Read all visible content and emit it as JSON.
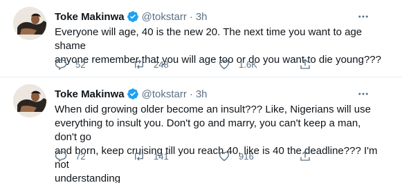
{
  "tweets": [
    {
      "name": "Toke Makinwa",
      "handle": "@tokstarr",
      "separator": "·",
      "time": "3h",
      "lines": [
        "Everyone will age, 40 is the new 20. The next time you want to age shame",
        "anyone remember that you will age too or do you want to die young???"
      ],
      "replies": "52",
      "retweets": "248",
      "likes": "1.6K"
    },
    {
      "name": "Toke Makinwa",
      "handle": "@tokstarr",
      "separator": "·",
      "time": "3h",
      "lines": [
        "When did growing older become an insult??? Like, Nigerians will use",
        "everything to insult you. Don't go and marry, you can't keep a man, don't go",
        "and born, keep cruising till you reach 40, like is 40 the deadline??? I'm not",
        "understanding"
      ],
      "replies": "72",
      "retweets": "141",
      "likes": "916"
    }
  ],
  "icons": {
    "verified": "verified-badge-icon",
    "more": "more-options-icon",
    "reply": "reply-icon",
    "retweet": "retweet-icon",
    "like": "heart-icon",
    "share": "share-icon"
  },
  "colors": {
    "text": "#0f1419",
    "secondary": "#5b7083",
    "verified": "#1da1f2",
    "divider": "#e6ecf0"
  }
}
